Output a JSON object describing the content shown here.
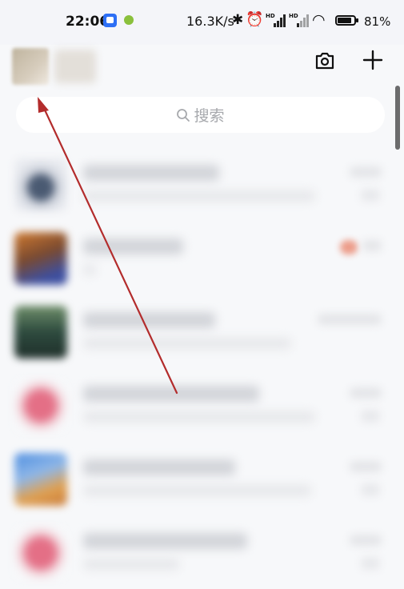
{
  "status_bar": {
    "time": "22:06",
    "network_speed": "16.3K/s",
    "battery_percent": "81%",
    "bluetooth_glyph": "✱",
    "alarm_glyph": "⏰",
    "wifi_glyph": "◠",
    "signal_label": "HD"
  },
  "header": {
    "camera_icon": "camera-icon",
    "add_icon": "plus-icon"
  },
  "search": {
    "placeholder": "搜索"
  },
  "chat_list": {
    "rows": [
      {
        "avatar_color": "#4a5a72"
      },
      {
        "avatar_color": "#3d4fa0"
      },
      {
        "avatar_color": "#2d4a3e"
      },
      {
        "avatar_color": "#e46f86"
      },
      {
        "avatar_color": "#4f8fe0"
      },
      {
        "avatar_color": "#e46f86"
      }
    ]
  },
  "annotation": {
    "arrow_color": "#b32c2c"
  }
}
